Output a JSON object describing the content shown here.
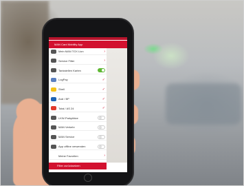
{
  "colors": {
    "brand": "#d2112f",
    "toggle_on": "#5fb834",
    "phone": "#141416"
  },
  "app": {
    "title": "MAN Card Mobility App"
  },
  "menu": {
    "items": [
      {
        "label": "Mein MAN TGX Lion",
        "icon": "truck-icon",
        "control": "chevron"
      },
      {
        "label": "Service Filter",
        "icon": "wrench-icon",
        "control": "chevron"
      },
      {
        "label": "Tankstellen Karten",
        "icon": "fuel-pump-icon",
        "control": "toggle-on"
      },
      {
        "label": "LogPay",
        "icon": "logpay-logo-icon",
        "control": "check"
      },
      {
        "label": "Shell",
        "icon": "shell-logo-icon",
        "control": "check"
      },
      {
        "label": "Aral / BP",
        "icon": "aral-logo-icon",
        "control": "check"
      },
      {
        "label": "Total / AS 24",
        "icon": "total-logo-icon",
        "control": "check"
      },
      {
        "label": "LKW-Parkplätze",
        "icon": "parking-icon",
        "control": "toggle-off"
      },
      {
        "label": "MAN Verkehr",
        "icon": "tools-icon",
        "control": "toggle-off"
      },
      {
        "label": "MAN Service",
        "icon": "service-icon",
        "control": "toggle-off"
      },
      {
        "label": "App offline verwenden",
        "icon": "wifi-icon",
        "control": "toggle-off"
      },
      {
        "label": "Meine Favoriten",
        "icon": "",
        "control": "chevron"
      }
    ],
    "reset_label": "Filter zurücksetzen"
  }
}
